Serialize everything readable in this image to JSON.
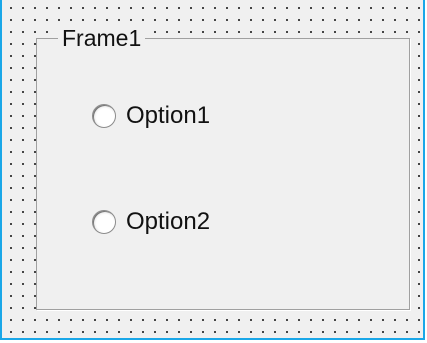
{
  "frame": {
    "caption": "Frame1"
  },
  "options": [
    {
      "label": "Option1",
      "selected": false
    },
    {
      "label": "Option2",
      "selected": false
    }
  ],
  "colors": {
    "form_border": "#1aa7e8",
    "surface": "#f0f0f0",
    "frame_border": "#a0a0a0"
  }
}
